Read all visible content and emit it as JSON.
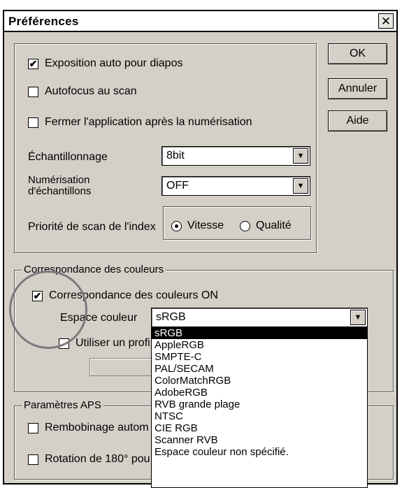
{
  "window": {
    "title": "Préférences",
    "close_glyph": "✕"
  },
  "buttons": {
    "ok": "OK",
    "cancel": "Annuler",
    "help": "Aide"
  },
  "general": {
    "auto_exposure": {
      "label": "Exposition auto pour diapos",
      "checked": true
    },
    "autofocus": {
      "label": "Autofocus au scan",
      "checked": false
    },
    "close_after": {
      "label": "Fermer l'application après la numérisation",
      "checked": false
    },
    "sampling": {
      "label": "Échantillonnage",
      "value": "8bit"
    },
    "multi_sampling": {
      "label_line1": "Numérisation",
      "label_line2": "d'échantillons",
      "value": "OFF"
    },
    "index_priority": {
      "label": "Priorité de scan de l'index",
      "options": [
        "Vitesse",
        "Qualité"
      ],
      "selected": "Vitesse"
    }
  },
  "color_matching": {
    "legend": "Correspondance des couleurs",
    "enabled": {
      "label": "Correspondance des couleurs ON",
      "checked": true
    },
    "space_label": "Espace couleur",
    "space_value": "sRGB",
    "use_profile": {
      "label": "Utiliser un profi",
      "checked": false
    },
    "dropdown_options": [
      "sRGB",
      "AppleRGB",
      "SMPTE-C",
      "PAL/SECAM",
      "ColorMatchRGB",
      "AdobeRGB",
      "RVB grande plage",
      "NTSC",
      "CIE RGB",
      "Scanner RVB",
      "Espace couleur non spécifié."
    ],
    "selected_option": "sRGB"
  },
  "aps": {
    "legend": "Paramètres APS",
    "rewind": {
      "label": "Rembobinage autom",
      "checked": false
    },
    "rotation": {
      "label": "Rotation de 180° pou",
      "checked": false
    }
  },
  "icons": {
    "check": "✔",
    "dropdown_arrow": "▼",
    "close": "close-icon"
  }
}
